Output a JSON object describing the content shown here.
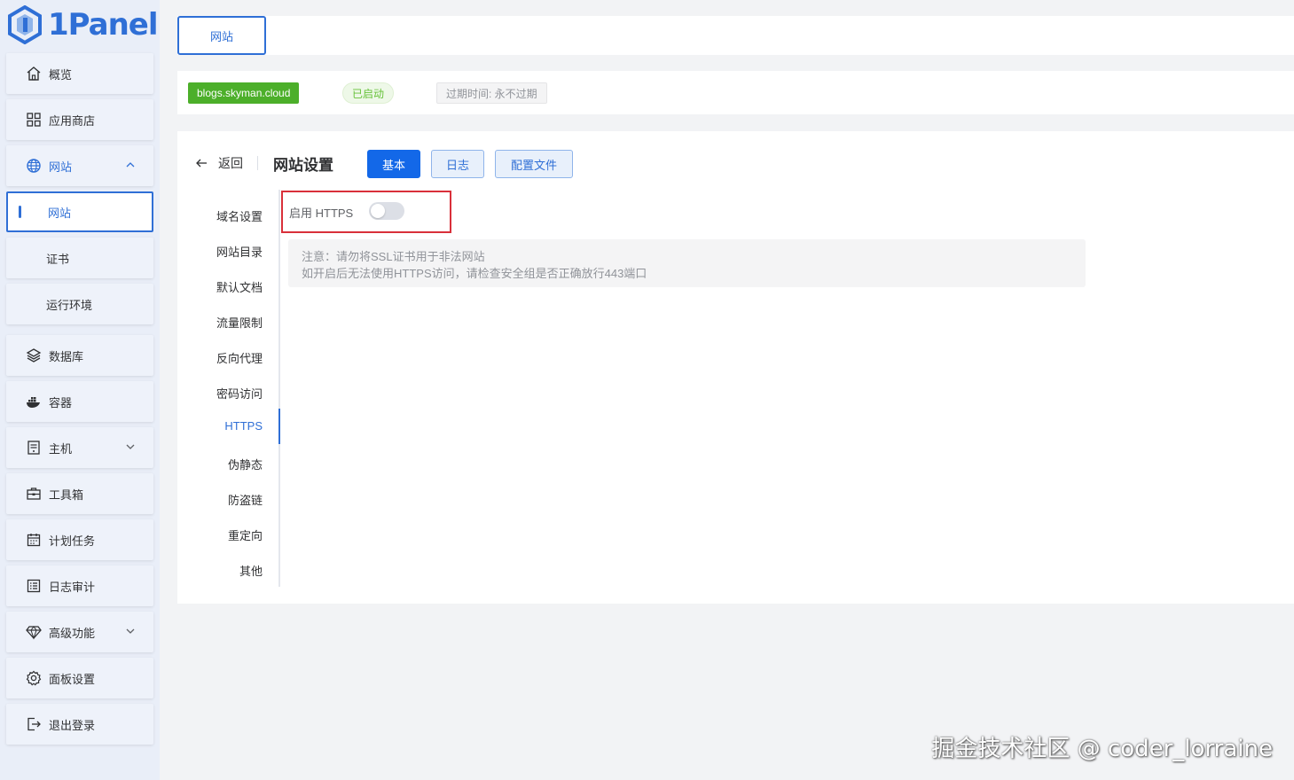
{
  "app": {
    "logo_text": "1Panel"
  },
  "sidebar": {
    "items": [
      {
        "label": "概览",
        "icon": "home-icon"
      },
      {
        "label": "应用商店",
        "icon": "grid-icon"
      },
      {
        "label": "网站",
        "icon": "globe-icon",
        "expanded": true
      },
      {
        "label": "网站",
        "active": true
      },
      {
        "label": "证书"
      },
      {
        "label": "运行环境"
      },
      {
        "label": "数据库",
        "icon": "layers-icon"
      },
      {
        "label": "容器",
        "icon": "docker-icon"
      },
      {
        "label": "主机",
        "icon": "host-icon"
      },
      {
        "label": "工具箱",
        "icon": "toolbox-icon"
      },
      {
        "label": "计划任务",
        "icon": "calendar-icon"
      },
      {
        "label": "日志审计",
        "icon": "log-icon"
      },
      {
        "label": "高级功能",
        "icon": "diamond-icon"
      },
      {
        "label": "面板设置",
        "icon": "gear-icon"
      },
      {
        "label": "退出登录",
        "icon": "logout-icon"
      }
    ]
  },
  "topbar": {
    "tab_label": "网站"
  },
  "site": {
    "domain": "blogs.skyman.cloud",
    "status": "已启动",
    "expire": "过期时间: 永不过期"
  },
  "panel": {
    "back_label": "返回",
    "title": "网站设置",
    "buttons": {
      "basic": "基本",
      "log": "日志",
      "config": "配置文件"
    },
    "subnav": [
      "域名设置",
      "网站目录",
      "默认文档",
      "流量限制",
      "反向代理",
      "密码访问",
      "HTTPS",
      "伪静态",
      "防盗链",
      "重定向",
      "其他"
    ],
    "subnav_active": "HTTPS",
    "https": {
      "label": "启用 HTTPS",
      "enabled": false
    },
    "notice": {
      "line1": "注意：请勿将SSL证书用于非法网站",
      "line2": "如开启后无法使用HTTPS访问，请检查安全组是否正确放行443端口"
    }
  },
  "watermark": "掘金技术社区 @ coder_lorraine",
  "colors": {
    "accent": "#2f6fd6",
    "primary_button": "#1368e8",
    "success": "#4caf2a",
    "highlight_border": "#d9303a"
  }
}
